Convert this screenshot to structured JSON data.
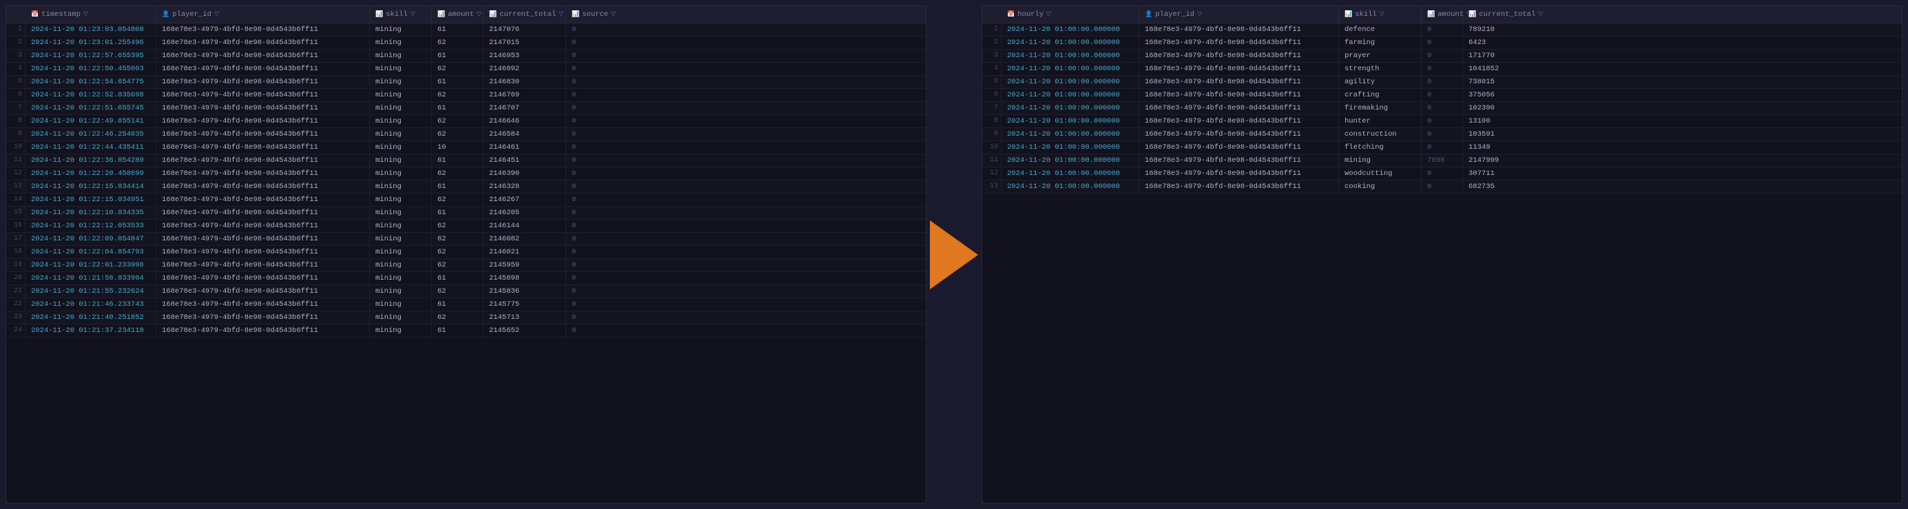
{
  "leftTable": {
    "columns": [
      {
        "id": "timestamp",
        "label": "timestamp",
        "icon": "📅",
        "hasFilter": true
      },
      {
        "id": "player_id",
        "label": "player_id",
        "icon": "👤",
        "hasFilter": true
      },
      {
        "id": "skill",
        "label": "skill",
        "icon": "📊",
        "hasFilter": true
      },
      {
        "id": "amount",
        "label": "amount",
        "icon": "📊",
        "hasFilter": true
      },
      {
        "id": "current_total",
        "label": "current_total",
        "icon": "📊",
        "hasFilter": true
      },
      {
        "id": "source",
        "label": "source",
        "icon": "📊",
        "hasFilter": true
      }
    ],
    "rows": [
      {
        "n": 1,
        "timestamp": "2024-11-20 01:23:03.054808",
        "player": "168e78e3-4979-4bfd-8e98-0d4543b6ff11",
        "skill": "mining",
        "amount": "61",
        "current": "2147076",
        "source": "0"
      },
      {
        "n": 2,
        "timestamp": "2024-11-20 01:23:01.255496",
        "player": "168e78e3-4979-4bfd-8e98-0d4543b6ff11",
        "skill": "mining",
        "amount": "62",
        "current": "2147015",
        "source": "0"
      },
      {
        "n": 3,
        "timestamp": "2024-11-20 01:22:57.655395",
        "player": "168e78e3-4979-4bfd-8e98-0d4543b6ff11",
        "skill": "mining",
        "amount": "61",
        "current": "2146953",
        "source": "0"
      },
      {
        "n": 4,
        "timestamp": "2024-11-20 01:22:50.455063",
        "player": "168e78e3-4979-4bfd-8e98-0d4543b6ff11",
        "skill": "mining",
        "amount": "62",
        "current": "2146892",
        "source": "0"
      },
      {
        "n": 5,
        "timestamp": "2024-11-20 01:22:54.654775",
        "player": "168e78e3-4979-4bfd-8e98-0d4543b6ff11",
        "skill": "mining",
        "amount": "61",
        "current": "2146830",
        "source": "0"
      },
      {
        "n": 6,
        "timestamp": "2024-11-20 01:22:52.835698",
        "player": "168e78e3-4979-4bfd-8e98-0d4543b6ff11",
        "skill": "mining",
        "amount": "62",
        "current": "2146769",
        "source": "0"
      },
      {
        "n": 7,
        "timestamp": "2024-11-20 01:22:51.655745",
        "player": "168e78e3-4979-4bfd-8e98-0d4543b6ff11",
        "skill": "mining",
        "amount": "61",
        "current": "2146707",
        "source": "0"
      },
      {
        "n": 8,
        "timestamp": "2024-11-20 01:22:49.855141",
        "player": "168e78e3-4979-4bfd-8e98-0d4543b6ff11",
        "skill": "mining",
        "amount": "62",
        "current": "2146646",
        "source": "0"
      },
      {
        "n": 9,
        "timestamp": "2024-11-20 01:22:46.254035",
        "player": "168e78e3-4979-4bfd-8e98-0d4543b6ff11",
        "skill": "mining",
        "amount": "62",
        "current": "2146584",
        "source": "0"
      },
      {
        "n": 10,
        "timestamp": "2024-11-20 01:22:44.435411",
        "player": "168e78e3-4979-4bfd-8e98-0d4543b6ff11",
        "skill": "mining",
        "amount": "10",
        "current": "2146461",
        "source": "0"
      },
      {
        "n": 11,
        "timestamp": "2024-11-20 01:22:36.054289",
        "player": "168e78e3-4979-4bfd-8e98-0d4543b6ff11",
        "skill": "mining",
        "amount": "61",
        "current": "2146451",
        "source": "0"
      },
      {
        "n": 12,
        "timestamp": "2024-11-20 01:22:20.458699",
        "player": "168e78e3-4979-4bfd-8e98-0d4543b6ff11",
        "skill": "mining",
        "amount": "62",
        "current": "2146390",
        "source": "0"
      },
      {
        "n": 13,
        "timestamp": "2024-11-20 01:22:15.834414",
        "player": "168e78e3-4979-4bfd-8e98-0d4543b6ff11",
        "skill": "mining",
        "amount": "61",
        "current": "2146328",
        "source": "0"
      },
      {
        "n": 14,
        "timestamp": "2024-11-20 01:22:15.034951",
        "player": "168e78e3-4979-4bfd-8e98-0d4543b6ff11",
        "skill": "mining",
        "amount": "62",
        "current": "2146267",
        "source": "0"
      },
      {
        "n": 15,
        "timestamp": "2024-11-20 01:22:10.834335",
        "player": "168e78e3-4979-4bfd-8e98-0d4543b6ff11",
        "skill": "mining",
        "amount": "61",
        "current": "2146205",
        "source": "0"
      },
      {
        "n": 16,
        "timestamp": "2024-11-20 01:22:12.053533",
        "player": "168e78e3-4979-4bfd-8e98-0d4543b6ff11",
        "skill": "mining",
        "amount": "62",
        "current": "2146144",
        "source": "0"
      },
      {
        "n": 17,
        "timestamp": "2024-11-20 01:22:09.054847",
        "player": "168e78e3-4979-4bfd-8e98-0d4543b6ff11",
        "skill": "mining",
        "amount": "62",
        "current": "2146082",
        "source": "0"
      },
      {
        "n": 18,
        "timestamp": "2024-11-20 01:22:04.854793",
        "player": "168e78e3-4979-4bfd-8e98-0d4543b6ff11",
        "skill": "mining",
        "amount": "62",
        "current": "2146021",
        "source": "0"
      },
      {
        "n": 19,
        "timestamp": "2024-11-20 01:22:01.233998",
        "player": "168e78e3-4979-4bfd-8e98-0d4543b6ff11",
        "skill": "mining",
        "amount": "62",
        "current": "2145959",
        "source": "0"
      },
      {
        "n": 20,
        "timestamp": "2024-11-20 01:21:58.833904",
        "player": "168e78e3-4979-4bfd-8e98-0d4543b6ff11",
        "skill": "mining",
        "amount": "61",
        "current": "2145898",
        "source": "0"
      },
      {
        "n": 21,
        "timestamp": "2024-11-20 01:21:55.232624",
        "player": "168e78e3-4979-4bfd-8e98-0d4543b6ff11",
        "skill": "mining",
        "amount": "62",
        "current": "2145836",
        "source": "0"
      },
      {
        "n": 22,
        "timestamp": "2024-11-20 01:21:46.233743",
        "player": "168e78e3-4979-4bfd-8e98-0d4543b6ff11",
        "skill": "mining",
        "amount": "61",
        "current": "2145775",
        "source": "0"
      },
      {
        "n": 23,
        "timestamp": "2024-11-20 01:21:40.251852",
        "player": "168e78e3-4979-4bfd-8e98-0d4543b6ff11",
        "skill": "mining",
        "amount": "62",
        "current": "2145713",
        "source": "0"
      },
      {
        "n": 24,
        "timestamp": "2024-11-20 01:21:37.234118",
        "player": "168e78e3-4979-4bfd-8e98-0d4543b6ff11",
        "skill": "mining",
        "amount": "61",
        "current": "2145652",
        "source": "0"
      }
    ]
  },
  "rightTable": {
    "columns": [
      {
        "id": "hourly",
        "label": "hourly",
        "icon": "📅",
        "hasFilter": true
      },
      {
        "id": "player_id",
        "label": "player_id",
        "icon": "👤",
        "hasFilter": true
      },
      {
        "id": "skill",
        "label": "skill",
        "icon": "📊",
        "hasFilter": true
      },
      {
        "id": "amount",
        "label": "amount",
        "icon": "📊",
        "hasFilter": true
      },
      {
        "id": "current_total",
        "label": "current_total",
        "icon": "📊",
        "hasFilter": true
      }
    ],
    "rows": [
      {
        "n": 1,
        "hourly": "2024-11-20 01:00:00.000000",
        "player": "168e78e3-4979-4bfd-8e98-0d4543b6ff11",
        "skill": "defence",
        "amount": "0",
        "current": "789210"
      },
      {
        "n": 2,
        "hourly": "2024-11-20 01:00:00.000000",
        "player": "168e78e3-4979-4bfd-8e98-0d4543b6ff11",
        "skill": "farming",
        "amount": "0",
        "current": "6423"
      },
      {
        "n": 3,
        "hourly": "2024-11-20 01:00:00.000000",
        "player": "168e78e3-4979-4bfd-8e98-0d4543b6ff11",
        "skill": "prayer",
        "amount": "0",
        "current": "171770"
      },
      {
        "n": 4,
        "hourly": "2024-11-20 01:00:00.000000",
        "player": "168e78e3-4979-4bfd-8e98-0d4543b6ff11",
        "skill": "strength",
        "amount": "0",
        "current": "1041852"
      },
      {
        "n": 5,
        "hourly": "2024-11-20 01:00:00.000000",
        "player": "168e78e3-4979-4bfd-8e98-0d4543b6ff11",
        "skill": "agility",
        "amount": "0",
        "current": "738015"
      },
      {
        "n": 6,
        "hourly": "2024-11-20 01:00:00.000000",
        "player": "168e78e3-4979-4bfd-8e98-0d4543b6ff11",
        "skill": "crafting",
        "amount": "0",
        "current": "375056"
      },
      {
        "n": 7,
        "hourly": "2024-11-20 01:00:00.000000",
        "player": "168e78e3-4979-4bfd-8e98-0d4543b6ff11",
        "skill": "firemaking",
        "amount": "0",
        "current": "102390"
      },
      {
        "n": 8,
        "hourly": "2024-11-20 01:00:00.000000",
        "player": "168e78e3-4979-4bfd-8e98-0d4543b6ff11",
        "skill": "hunter",
        "amount": "0",
        "current": "13100"
      },
      {
        "n": 9,
        "hourly": "2024-11-20 01:00:00.000000",
        "player": "168e78e3-4979-4bfd-8e98-0d4543b6ff11",
        "skill": "construction",
        "amount": "0",
        "current": "103591"
      },
      {
        "n": 10,
        "hourly": "2024-11-20 01:00:00.000000",
        "player": "168e78e3-4979-4bfd-8e98-0d4543b6ff11",
        "skill": "fletching",
        "amount": "0",
        "current": "11349"
      },
      {
        "n": 11,
        "hourly": "2024-11-20 01:00:00.000000",
        "player": "168e78e3-4979-4bfd-8e98-0d4543b6ff11",
        "skill": "mining",
        "amount": "7898",
        "current": "2147999"
      },
      {
        "n": 12,
        "hourly": "2024-11-20 01:00:00.000000",
        "player": "168e78e3-4979-4bfd-8e98-0d4543b6ff11",
        "skill": "woodcutting",
        "amount": "0",
        "current": "307711"
      },
      {
        "n": 13,
        "hourly": "2024-11-20 01:00:00.000000",
        "player": "168e78e3-4979-4bfd-8e98-0d4543b6ff11",
        "skill": "cooking",
        "amount": "0",
        "current": "682735"
      }
    ]
  }
}
